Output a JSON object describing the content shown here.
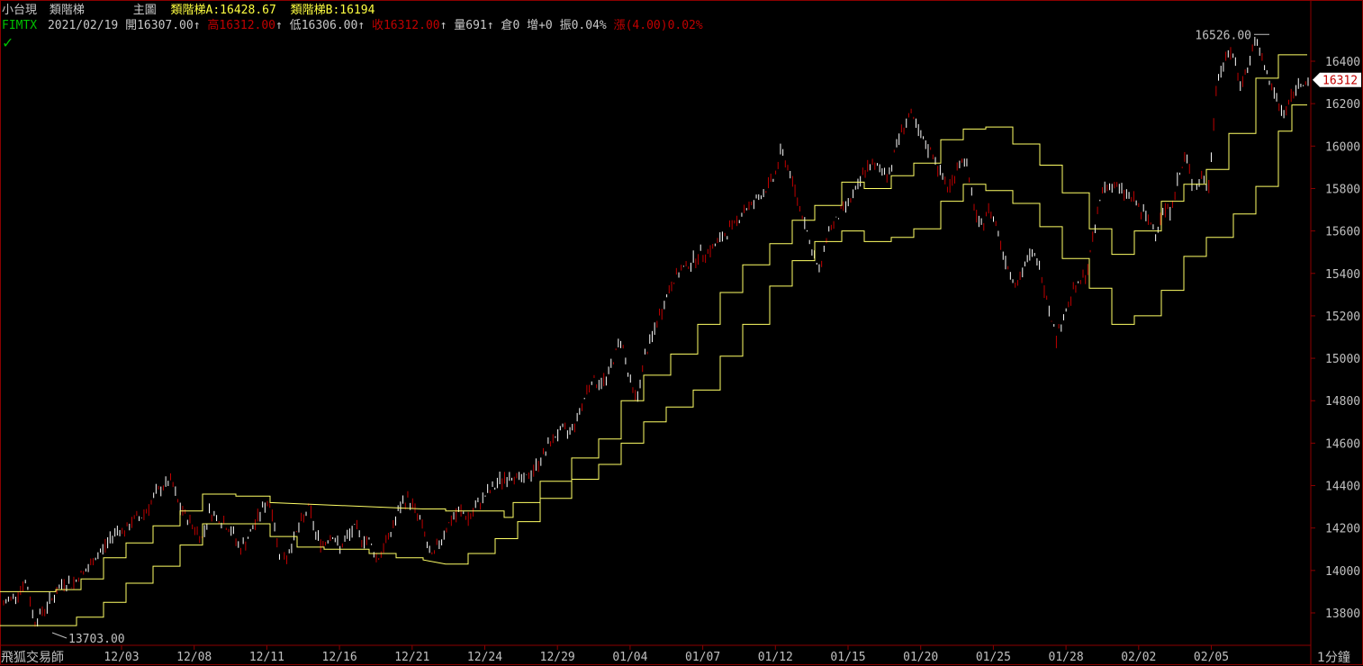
{
  "header": {
    "instrument": "小台現",
    "indicator": "類階梯",
    "chart_label": "主圖",
    "ladder_a_label": "類階梯A:16428.67",
    "ladder_b_label": "類階梯B:16194",
    "symbol": "FIMTX",
    "date": "2021/02/19",
    "open_label": "開",
    "open": "16307.00",
    "high_label": "高",
    "high": "16312.00",
    "low_label": "低",
    "low": "16306.00",
    "close_label": "收",
    "close": "16312.00",
    "volume_label": "量",
    "volume": "691",
    "oi_label": "倉",
    "oi": "0",
    "inc_label": "增",
    "inc": "+0",
    "amp_label": "振",
    "amp": "0.04%",
    "change_label": "漲",
    "change": "(4.00)",
    "change_pct": "0.02%",
    "arrow": "↑"
  },
  "footer": {
    "brand": "飛狐交易師",
    "period": "1分鐘"
  },
  "colors": {
    "background": "#000000",
    "ladder": "#ffff66",
    "candle_up": "#ffffff",
    "candle_down": "#c00000",
    "frame": "#8b0000",
    "last_price_bg": "#ffffff",
    "last_price_text": "#c00000"
  },
  "chart_data": {
    "type": "candlestick",
    "x_ticks": [
      "12/03",
      "12/08",
      "12/11",
      "12/16",
      "12/21",
      "12/24",
      "12/29",
      "01/04",
      "01/07",
      "01/12",
      "01/15",
      "01/20",
      "01/25",
      "01/28",
      "02/02",
      "02/05"
    ],
    "y_ticks": [
      13800,
      14000,
      14200,
      14400,
      14600,
      14800,
      15000,
      15200,
      15400,
      15600,
      15800,
      16000,
      16200,
      16400
    ],
    "ylim": [
      13720,
      16580
    ],
    "last_price": "16312",
    "max_label": "16526.00",
    "min_label": "13703.00",
    "price_path": [
      13840,
      13870,
      13900,
      13950,
      13760,
      13800,
      13850,
      13900,
      13950,
      13930,
      13980,
      14000,
      14060,
      14100,
      14150,
      14200,
      14180,
      14240,
      14250,
      14300,
      14360,
      14400,
      14420,
      14300,
      14250,
      14200,
      14150,
      14280,
      14250,
      14220,
      14180,
      14100,
      14150,
      14220,
      14300,
      14320,
      14100,
      14050,
      14150,
      14220,
      14300,
      14160,
      14120,
      14180,
      14100,
      14150,
      14200,
      14150,
      14140,
      14050,
      14120,
      14200,
      14300,
      14340,
      14280,
      14200,
      14050,
      14120,
      14200,
      14250,
      14280,
      14240,
      14300,
      14350,
      14380,
      14420,
      14440,
      14450,
      14420,
      14450,
      14500,
      14560,
      14620,
      14660,
      14650,
      14700,
      14800,
      14900,
      14880,
      14900,
      15000,
      15100,
      14900,
      14800,
      15000,
      15100,
      15200,
      15300,
      15380,
      15420,
      15450,
      15480,
      15500,
      15520,
      15560,
      15600,
      15640,
      15700,
      15720,
      15760,
      15800,
      15850,
      15980,
      15880,
      15750,
      15650,
      15500,
      15400,
      15600,
      15640,
      15700,
      15750,
      15800,
      15900,
      15900,
      15900,
      15860,
      16000,
      16100,
      16150,
      16050,
      16000,
      15950,
      15850,
      15800,
      15900,
      15950,
      15750,
      15600,
      15700,
      15650,
      15500,
      15400,
      15350,
      15450,
      15500,
      15400,
      15250,
      15100,
      15200,
      15300,
      15350,
      15400,
      15600,
      15800,
      15820,
      15800,
      15780,
      15750,
      15700,
      15650,
      15600,
      15700,
      15700,
      15850,
      15950,
      15800,
      15850,
      15800,
      16300,
      16400,
      16450,
      16300,
      16350,
      16500,
      16400,
      16300,
      16200,
      16150,
      16250,
      16300,
      16312
    ],
    "ladder_a": [
      [
        0,
        13900
      ],
      [
        62,
        13900
      ],
      [
        62,
        13910
      ],
      [
        90,
        13910
      ],
      [
        90,
        13960
      ],
      [
        115,
        13960
      ],
      [
        115,
        14060
      ],
      [
        140,
        14060
      ],
      [
        140,
        14130
      ],
      [
        170,
        14130
      ],
      [
        170,
        14210
      ],
      [
        200,
        14210
      ],
      [
        200,
        14280
      ],
      [
        225,
        14280
      ],
      [
        225,
        14360
      ],
      [
        262,
        14360
      ],
      [
        262,
        14350
      ],
      [
        300,
        14350
      ],
      [
        300,
        14320
      ],
      [
        470,
        14290
      ],
      [
        495,
        14290
      ],
      [
        495,
        14280
      ],
      [
        560,
        14280
      ],
      [
        560,
        14250
      ],
      [
        570,
        14250
      ],
      [
        570,
        14320
      ],
      [
        600,
        14320
      ],
      [
        600,
        14420
      ],
      [
        635,
        14420
      ],
      [
        635,
        14530
      ],
      [
        665,
        14530
      ],
      [
        665,
        14620
      ],
      [
        690,
        14620
      ],
      [
        690,
        14800
      ],
      [
        715,
        14800
      ],
      [
        715,
        14920
      ],
      [
        745,
        14920
      ],
      [
        745,
        15020
      ],
      [
        775,
        15020
      ],
      [
        775,
        15160
      ],
      [
        800,
        15160
      ],
      [
        800,
        15310
      ],
      [
        825,
        15310
      ],
      [
        825,
        15440
      ],
      [
        855,
        15440
      ],
      [
        855,
        15540
      ],
      [
        880,
        15540
      ],
      [
        880,
        15650
      ],
      [
        905,
        15650
      ],
      [
        905,
        15720
      ],
      [
        935,
        15720
      ],
      [
        935,
        15830
      ],
      [
        960,
        15830
      ],
      [
        960,
        15800
      ],
      [
        990,
        15800
      ],
      [
        990,
        15860
      ],
      [
        1015,
        15860
      ],
      [
        1015,
        15920
      ],
      [
        1045,
        15920
      ],
      [
        1045,
        16030
      ],
      [
        1070,
        16030
      ],
      [
        1070,
        16080
      ],
      [
        1095,
        16080
      ],
      [
        1095,
        16090
      ],
      [
        1125,
        16090
      ],
      [
        1125,
        16010
      ],
      [
        1155,
        16010
      ],
      [
        1155,
        15910
      ],
      [
        1180,
        15910
      ],
      [
        1180,
        15780
      ],
      [
        1210,
        15780
      ],
      [
        1210,
        15610
      ],
      [
        1235,
        15610
      ],
      [
        1235,
        15490
      ],
      [
        1260,
        15490
      ],
      [
        1260,
        15600
      ],
      [
        1290,
        15600
      ],
      [
        1290,
        15740
      ],
      [
        1315,
        15740
      ],
      [
        1315,
        15820
      ],
      [
        1340,
        15820
      ],
      [
        1340,
        15890
      ],
      [
        1365,
        15890
      ],
      [
        1365,
        16060
      ],
      [
        1395,
        16060
      ],
      [
        1395,
        16320
      ],
      [
        1420,
        16320
      ],
      [
        1420,
        16430
      ],
      [
        1452,
        16430
      ]
    ],
    "ladder_b": [
      [
        0,
        13740
      ],
      [
        38,
        13740
      ],
      [
        38,
        13740
      ],
      [
        85,
        13740
      ],
      [
        85,
        13780
      ],
      [
        115,
        13780
      ],
      [
        115,
        13850
      ],
      [
        140,
        13850
      ],
      [
        140,
        13940
      ],
      [
        170,
        13940
      ],
      [
        170,
        14020
      ],
      [
        200,
        14020
      ],
      [
        200,
        14120
      ],
      [
        225,
        14120
      ],
      [
        225,
        14220
      ],
      [
        262,
        14220
      ],
      [
        262,
        14220
      ],
      [
        300,
        14220
      ],
      [
        300,
        14160
      ],
      [
        330,
        14160
      ],
      [
        330,
        14110
      ],
      [
        360,
        14110
      ],
      [
        360,
        14100
      ],
      [
        410,
        14100
      ],
      [
        410,
        14080
      ],
      [
        440,
        14080
      ],
      [
        440,
        14060
      ],
      [
        470,
        14060
      ],
      [
        470,
        14050
      ],
      [
        495,
        14030
      ],
      [
        520,
        14030
      ],
      [
        520,
        14080
      ],
      [
        550,
        14080
      ],
      [
        550,
        14150
      ],
      [
        575,
        14150
      ],
      [
        575,
        14230
      ],
      [
        600,
        14230
      ],
      [
        600,
        14340
      ],
      [
        635,
        14340
      ],
      [
        635,
        14430
      ],
      [
        665,
        14430
      ],
      [
        665,
        14500
      ],
      [
        690,
        14500
      ],
      [
        690,
        14600
      ],
      [
        715,
        14600
      ],
      [
        715,
        14700
      ],
      [
        740,
        14700
      ],
      [
        740,
        14770
      ],
      [
        770,
        14770
      ],
      [
        770,
        14850
      ],
      [
        800,
        14850
      ],
      [
        800,
        15010
      ],
      [
        825,
        15010
      ],
      [
        825,
        15160
      ],
      [
        855,
        15160
      ],
      [
        855,
        15340
      ],
      [
        880,
        15340
      ],
      [
        880,
        15460
      ],
      [
        905,
        15460
      ],
      [
        905,
        15550
      ],
      [
        935,
        15550
      ],
      [
        935,
        15600
      ],
      [
        960,
        15600
      ],
      [
        960,
        15550
      ],
      [
        990,
        15550
      ],
      [
        990,
        15570
      ],
      [
        1015,
        15570
      ],
      [
        1015,
        15610
      ],
      [
        1045,
        15610
      ],
      [
        1045,
        15740
      ],
      [
        1070,
        15740
      ],
      [
        1070,
        15820
      ],
      [
        1095,
        15820
      ],
      [
        1095,
        15790
      ],
      [
        1125,
        15790
      ],
      [
        1125,
        15730
      ],
      [
        1155,
        15730
      ],
      [
        1155,
        15620
      ],
      [
        1180,
        15620
      ],
      [
        1180,
        15470
      ],
      [
        1210,
        15470
      ],
      [
        1210,
        15330
      ],
      [
        1235,
        15330
      ],
      [
        1235,
        15160
      ],
      [
        1260,
        15160
      ],
      [
        1260,
        15200
      ],
      [
        1290,
        15200
      ],
      [
        1290,
        15320
      ],
      [
        1315,
        15320
      ],
      [
        1315,
        15480
      ],
      [
        1340,
        15480
      ],
      [
        1340,
        15570
      ],
      [
        1370,
        15570
      ],
      [
        1370,
        15680
      ],
      [
        1395,
        15680
      ],
      [
        1395,
        15810
      ],
      [
        1420,
        15810
      ],
      [
        1420,
        16070
      ],
      [
        1435,
        16070
      ],
      [
        1435,
        16194
      ],
      [
        1452,
        16194
      ]
    ]
  }
}
